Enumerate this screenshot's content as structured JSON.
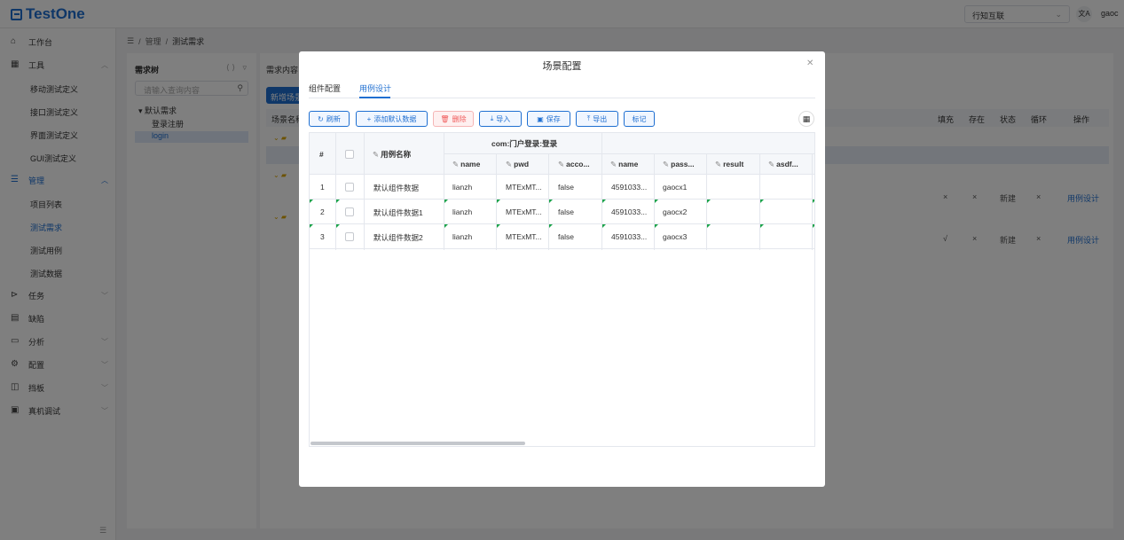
{
  "header": {
    "logo": "TestOne",
    "project": "行知互联",
    "lang_icon": "文A",
    "user": "gaoc"
  },
  "sidebar": {
    "items": [
      {
        "label": "工作台",
        "icon": "home-icon"
      },
      {
        "label": "工具",
        "icon": "grid-icon"
      },
      {
        "label": "管理",
        "icon": "list-icon"
      },
      {
        "label": "任务",
        "icon": "send-icon"
      },
      {
        "label": "缺陷",
        "icon": "doc-icon"
      },
      {
        "label": "分析",
        "icon": "calendar-icon"
      },
      {
        "label": "配置",
        "icon": "gear-icon"
      },
      {
        "label": "挡板",
        "icon": "panel-icon"
      },
      {
        "label": "真机调试",
        "icon": "device-icon"
      }
    ],
    "tools_sub": [
      "移动测试定义",
      "接口测试定义",
      "界面测试定义",
      "GUI测试定义"
    ],
    "manage_sub": [
      "项目列表",
      "测试需求",
      "测试用例",
      "测试数据"
    ]
  },
  "breadcrumb": {
    "items": [
      "管理",
      "测试需求"
    ]
  },
  "tree": {
    "title": "需求树",
    "search_placeholder": "请输入查询内容",
    "root": "默认需求",
    "child1": "登录注册",
    "child2": "login"
  },
  "main": {
    "title": "需求内容",
    "new_button": "新增场景",
    "col_name": "场景名称",
    "columns": [
      "填充",
      "存在",
      "状态",
      "循环",
      "操作"
    ],
    "rows": [
      {
        "fill": "×",
        "exists": "×",
        "status": "新建",
        "loop": "×",
        "action": "用例设计"
      },
      {
        "fill": "√",
        "exists": "×",
        "status": "新建",
        "loop": "×",
        "action": "用例设计"
      }
    ]
  },
  "dialog": {
    "title": "场景配置",
    "tabs": [
      "组件配置",
      "用例设计"
    ],
    "toolbar": {
      "refresh": "刷新",
      "add_default": "添加默认数据",
      "delete": "删除",
      "import": "导入",
      "save": "保存",
      "export": "导出",
      "mark": "标记"
    },
    "table": {
      "col_index": "#",
      "col_case_name": "用例名称",
      "group_header": "com:门户登录:登录",
      "columns": [
        "name",
        "pwd",
        "acco...",
        "name",
        "pass...",
        "result",
        "asdf..."
      ],
      "rows": [
        {
          "index": "1",
          "case": "默认组件数据",
          "cells": [
            "lianzh",
            "MTExMT...",
            "false",
            "4591033...",
            "gaocx1",
            "",
            ""
          ]
        },
        {
          "index": "2",
          "case": "默认组件数据1",
          "cells": [
            "lianzh",
            "MTExMT...",
            "false",
            "4591033...",
            "gaocx2",
            "",
            ""
          ]
        },
        {
          "index": "3",
          "case": "默认组件数据2",
          "cells": [
            "lianzh",
            "MTExMT...",
            "false",
            "4591033...",
            "gaocx3",
            "",
            ""
          ]
        }
      ]
    }
  }
}
